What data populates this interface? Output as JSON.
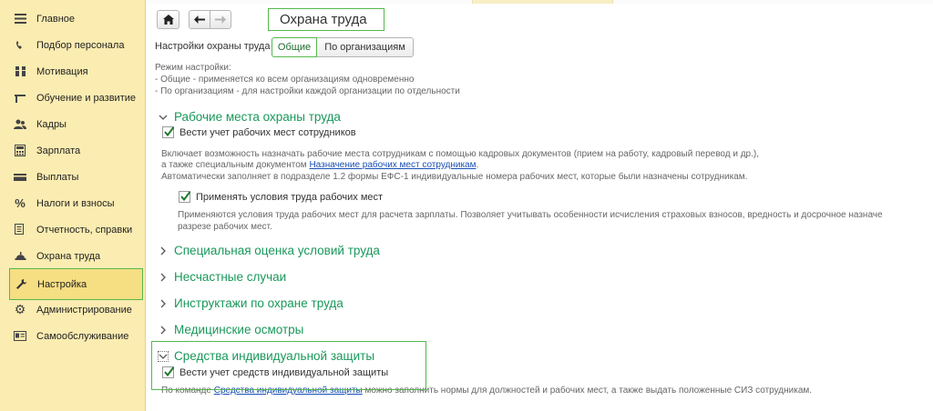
{
  "sidebar": {
    "items": [
      {
        "label": "Главное",
        "icon": "menu-icon"
      },
      {
        "label": "Подбор персонала",
        "icon": "headset-icon"
      },
      {
        "label": "Мотивация",
        "icon": "people-icon"
      },
      {
        "label": "Обучение и развитие",
        "icon": "graduation-cap-icon"
      },
      {
        "label": "Кадры",
        "icon": "users-icon"
      },
      {
        "label": "Зарплата",
        "icon": "calculator-icon"
      },
      {
        "label": "Выплаты",
        "icon": "wallet-icon"
      },
      {
        "label": "Налоги и взносы",
        "icon": "percent-icon"
      },
      {
        "label": "Отчетность, справки",
        "icon": "report-icon"
      },
      {
        "label": "Охрана труда",
        "icon": "hard-hat-icon"
      },
      {
        "label": "Настройка",
        "icon": "wrench-icon"
      },
      {
        "label": "Администрирование",
        "icon": "gear-icon"
      },
      {
        "label": "Самообслуживание",
        "icon": "id-card-icon"
      }
    ],
    "active_index": 10
  },
  "header": {
    "title": "Охрана труда"
  },
  "settings": {
    "label": "Настройки охраны труда",
    "options": [
      "Общие",
      "По организациям"
    ],
    "selected": "Общие"
  },
  "mode_note": {
    "line1": "Режим настройки:",
    "line2": "- Общие - применяется ко всем организациям одновременно",
    "line3": "- По организациям - для настройки каждой организации по отдельности"
  },
  "sections": {
    "workplaces": {
      "title": "Рабочие места охраны труда",
      "expanded": true,
      "checkbox_label": "Вести учет рабочих мест сотрудников",
      "checked": true,
      "desc_line1": "Включает возможность назначать рабочие места сотрудникам с помощью кадровых документов (прием на работу, кадровый перевод и др.),",
      "desc_line2_pre": "а также специальным документом ",
      "desc_line2_link": "Назначение рабочих мест сотрудникам",
      "desc_line2_post": ".",
      "desc_line3": "Автоматически заполняет в подразделе 1.2 формы ЕФС-1 индивидуальные номера рабочих мест, которые были назначены сотрудникам.",
      "sub_checkbox_label": "Применять условия труда рабочих мест",
      "sub_checked": true,
      "sub_desc_line1": "Применяются условия труда рабочих мест для расчета зарплаты. Позволяет учитывать особенности исчисления страховых взносов, вредность и досрочное назначе",
      "sub_desc_line2": "разрезе рабочих мест."
    },
    "special_assessment": {
      "title": "Специальная оценка условий труда",
      "expanded": false
    },
    "accidents": {
      "title": "Несчастные случаи",
      "expanded": false
    },
    "briefings": {
      "title": "Инструктажи по охране труда",
      "expanded": false
    },
    "medical": {
      "title": "Медицинские осмотры",
      "expanded": false
    },
    "ppe": {
      "title": "Средства индивидуальной защиты",
      "expanded": true,
      "checkbox_label": "Вести учет средств индивидуальной защиты",
      "checked": true,
      "desc_pre": "По команде ",
      "desc_link": "Средства индивидуальной защиты",
      "desc_post": " можно заполнить нормы для должностей и рабочих мест, а также выдать положенные СИЗ сотрудникам."
    }
  },
  "colors": {
    "sidebar_bg": "#fbecb1",
    "accent_green": "#19985a",
    "highlight_border": "#55b84c",
    "link": "#1a4fb4"
  }
}
